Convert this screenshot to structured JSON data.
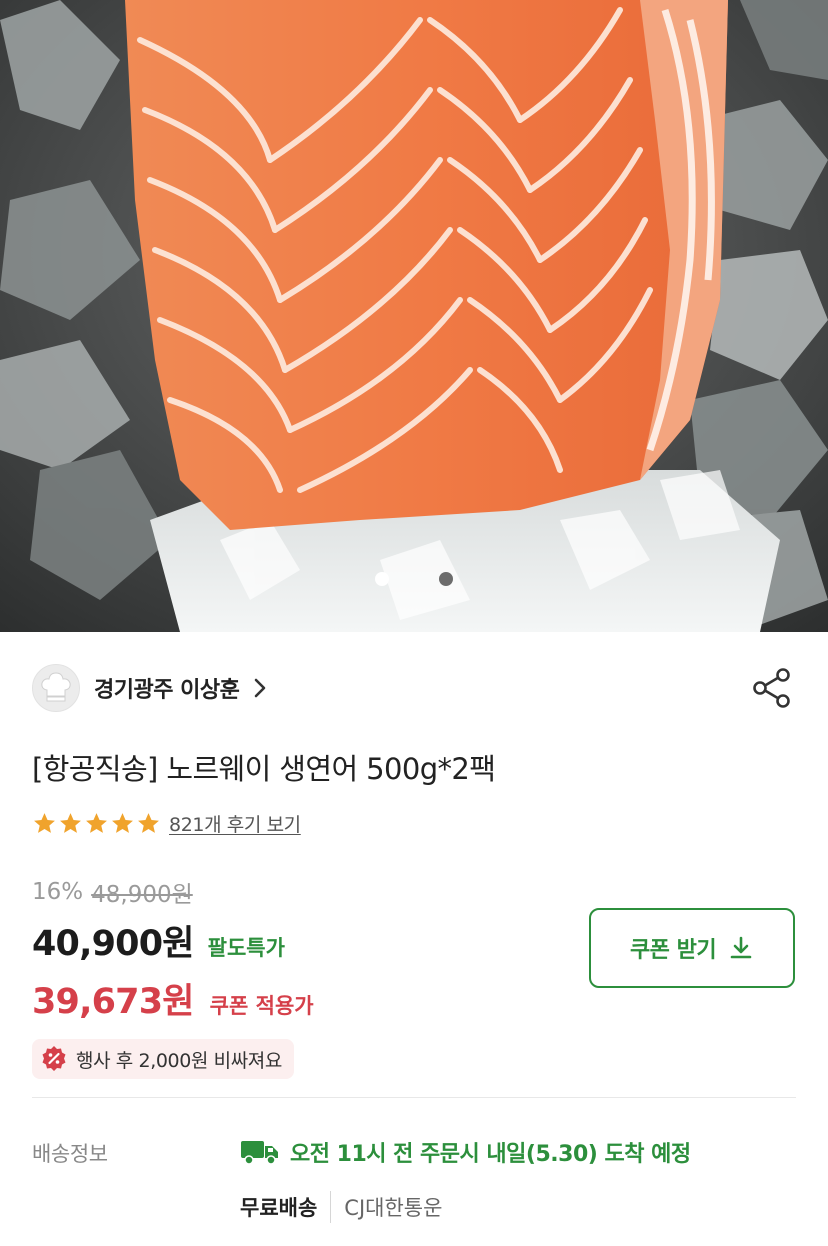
{
  "hero": {
    "image_alt": "salmon-fillet-on-ice",
    "dots": [
      {
        "active": true
      },
      {
        "active": false
      }
    ]
  },
  "seller": {
    "name": "경기광주 이상훈"
  },
  "product": {
    "title": "[항공직송] 노르웨이 생연어 500g*2팩",
    "rating_stars": 5,
    "review_link": "821개 후기 보기"
  },
  "price": {
    "discount": "16%",
    "original": "48,900원",
    "current": "40,900원",
    "special_label": "팔도특가",
    "coupon_price": "39,673원",
    "coupon_label": "쿠폰 적용가"
  },
  "coupon_button": {
    "label": "쿠폰 받기"
  },
  "notice_badge": {
    "text": "행사 후 2,000원 비싸져요"
  },
  "delivery": {
    "label": "배송정보",
    "eta": "오전 11시 전 주문시 내일(5.30) 도착 예정",
    "fee": "무료배송",
    "carrier": "CJ대한통운"
  },
  "colors": {
    "accent_green": "#2c8f3c",
    "accent_red": "#d5404a",
    "star": "#f0a32c"
  }
}
